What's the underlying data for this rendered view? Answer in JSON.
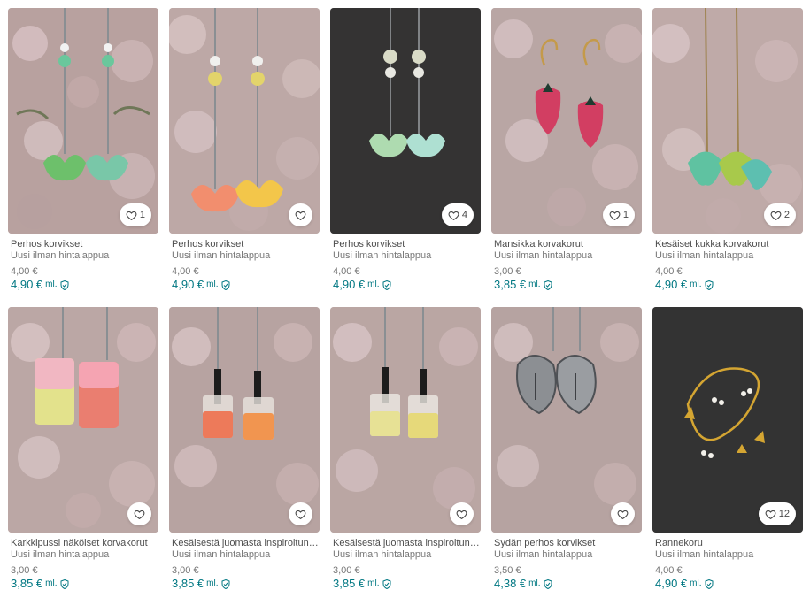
{
  "colors": {
    "accent": "#007782",
    "text_muted": "#767676"
  },
  "icons": {
    "favourite": "heart-outline-icon",
    "protection": "shield-check-icon"
  },
  "items": [
    {
      "title": "Perhos korvikset",
      "condition": "Uusi ilman hintalappua",
      "price": "4,00 €",
      "total": "4,90 €",
      "incl": "ml.",
      "likes": "1",
      "photo": "green butterfly earrings"
    },
    {
      "title": "Perhos korvikset",
      "condition": "Uusi ilman hintalappua",
      "price": "4,00 €",
      "total": "4,90 €",
      "incl": "ml.",
      "likes": "",
      "photo": "yellow butterfly earrings"
    },
    {
      "title": "Perhos korvikset",
      "condition": "Uusi ilman hintalappua",
      "price": "4,00 €",
      "total": "4,90 €",
      "incl": "ml.",
      "likes": "4",
      "photo": "mint butterfly earrings on dark background"
    },
    {
      "title": "Mansikka korvakorut",
      "condition": "Uusi ilman hintalappua",
      "price": "3,00 €",
      "total": "3,85 €",
      "incl": "ml.",
      "likes": "1",
      "photo": "strawberry earrings"
    },
    {
      "title": "Kesäiset kukka korvakorut",
      "condition": "Uusi ilman hintalappua",
      "price": "4,00 €",
      "total": "4,90 €",
      "incl": "ml.",
      "likes": "2",
      "photo": "green flower earrings"
    },
    {
      "title": "Karkkipussi näköiset korvakorut",
      "condition": "Uusi ilman hintalappua",
      "price": "3,00 €",
      "total": "3,85 €",
      "incl": "ml.",
      "likes": "",
      "photo": "candy bag earrings"
    },
    {
      "title": "Kesäisestä juomasta inspiroituneet ko...",
      "condition": "Uusi ilman hintalappua",
      "price": "3,00 €",
      "total": "3,85 €",
      "incl": "ml.",
      "likes": "",
      "photo": "drink glass earrings orange"
    },
    {
      "title": "Kesäisestä juomasta inspiroituneet ko...",
      "condition": "Uusi ilman hintalappua",
      "price": "3,00 €",
      "total": "3,85 €",
      "incl": "ml.",
      "likes": "",
      "photo": "drink glass earrings yellow"
    },
    {
      "title": "Sydän perhos korvikset",
      "condition": "Uusi ilman hintalappua",
      "price": "3,50 €",
      "total": "4,38 €",
      "incl": "ml.",
      "likes": "",
      "photo": "silver heart butterfly earrings"
    },
    {
      "title": "Rannekoru",
      "condition": "Uusi ilman hintalappua",
      "price": "4,00 €",
      "total": "4,90 €",
      "incl": "ml.",
      "likes": "12",
      "photo": "gold charm bracelet"
    }
  ]
}
